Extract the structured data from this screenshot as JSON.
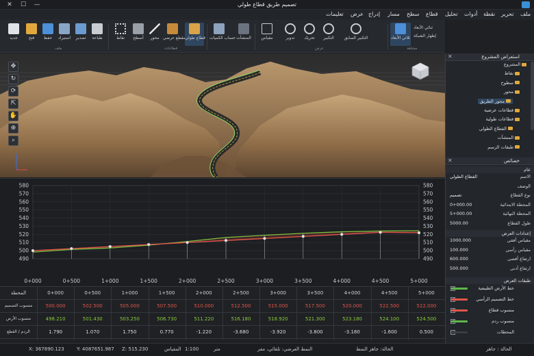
{
  "window": {
    "title": "تصميم طريق قطاع طولي",
    "minimize": "—",
    "maximize": "☐",
    "close": "✕"
  },
  "menu": [
    "ملف",
    "تحرير",
    "نقطة",
    "أدوات",
    "تحليل",
    "قطاع",
    "سطح",
    "مسار",
    "إدراج",
    "عرض",
    "تعليمات"
  ],
  "ribbon": {
    "file_buttons": [
      "جديد",
      "فتح",
      "حفظ",
      "استيراد",
      "تصدير",
      "طباعة"
    ],
    "file_group": "ملف",
    "draw_buttons": [
      "نقاط",
      "أسطح",
      "محور",
      "مقطع عرضي",
      "قطاع طولي"
    ],
    "draw_group": "قطاعات",
    "extra_buttons": [
      "حساب الكميات",
      "المنشآت",
      "مقياس",
      "تدوير",
      "تحريك",
      "التكبير",
      "التكبير السابق"
    ],
    "extra_group": "عرض",
    "view_buttons": [
      "ثلاثي الأبعاد"
    ],
    "view_side": [
      "ثنائي الأبعاد",
      "إظهار الشبكة"
    ],
    "view_group": "مشاهد"
  },
  "profile": {
    "y_ticks": [
      "580",
      "570",
      "560",
      "550",
      "540",
      "530",
      "520",
      "510",
      "500",
      "490"
    ],
    "x_ticks": [
      "0+000",
      "0+500",
      "1+000",
      "1+500",
      "2+000",
      "2+500",
      "3+000",
      "3+500",
      "4+000",
      "4+500",
      "5+000"
    ]
  },
  "table": {
    "header_label": "المحطة",
    "stations": [
      "0+000",
      "0+500",
      "1+000",
      "1+500",
      "2+000",
      "2+500",
      "3+000",
      "3+500",
      "4+000",
      "4+500",
      "5+000"
    ],
    "rows": [
      {
        "label": "منسوب التصميم",
        "color": "#e0564a",
        "values": [
          "500.000",
          "502.500",
          "505.000",
          "507.500",
          "510.000",
          "512.500",
          "515.000",
          "517.500",
          "520.000",
          "522.500",
          "522.000"
        ]
      },
      {
        "label": "منسوب الأرض",
        "color": "#8ccc3c",
        "values": [
          "498.210",
          "501.430",
          "503.250",
          "506.730",
          "511.220",
          "516.180",
          "518.920",
          "521.300",
          "523.180",
          "524.100",
          "524.500"
        ]
      },
      {
        "label": "الردم / القطع",
        "color": "#dcdfe3",
        "values": [
          "1.790",
          "1.070",
          "1.750",
          "0.770",
          "-1.220",
          "-3.680",
          "-3.920",
          "-3.800",
          "-3.180",
          "-1.600",
          "0.500"
        ]
      }
    ]
  },
  "status": {
    "x": "X: 367890.123",
    "y": "Y: 4087651.987",
    "z": "Z: 515.230",
    "scale_label": "المقياس",
    "scale": "1:100",
    "units": "متر",
    "mode": "النمط العرضي: تلقائي، مفر",
    "state_label": "الحالة: جاهز النمط",
    "ready": "الحالة : جاهز"
  },
  "explorer": {
    "title": "استعراض المشروع",
    "items": [
      {
        "label": "المشروع",
        "level": 0
      },
      {
        "label": "نقاط",
        "level": 1
      },
      {
        "label": "سطوح",
        "level": 1
      },
      {
        "label": "محور",
        "level": 1
      },
      {
        "label": "محور الطريق",
        "level": 2,
        "selected": true
      },
      {
        "label": "قطاعات عرضية",
        "level": 1
      },
      {
        "label": "قطاعات طولية",
        "level": 1
      },
      {
        "label": "القطاع الطولي",
        "level": 2
      },
      {
        "label": "المنشآت",
        "level": 1
      },
      {
        "label": "طبقات الرسم",
        "level": 1
      }
    ]
  },
  "properties": {
    "title": "خصائص",
    "general_head": "عام",
    "general": [
      {
        "k": "الاسم",
        "v": "القطاع الطولي"
      },
      {
        "k": "الوصف",
        "v": ""
      },
      {
        "k": "نوع القطاع",
        "v": "تصميم"
      },
      {
        "k": "المحطة الابتدائية",
        "v": "0+000.00"
      },
      {
        "k": "المحطة النهائية",
        "v": "5+000.00"
      },
      {
        "k": "طول القطاع",
        "v": "5000.00"
      }
    ],
    "display_head": "إعدادات العرض",
    "display": [
      {
        "k": "مقياس أفقي",
        "v": "1000.000"
      },
      {
        "k": "مقياس رأسي",
        "v": "100.000"
      },
      {
        "k": "ارتفاع أقصى",
        "v": "600.000"
      },
      {
        "k": "ارتفاع أدنى",
        "v": "500.000"
      }
    ]
  },
  "layers": {
    "title": "طبقات العرض",
    "items": [
      {
        "label": "خط الأرض الطبيعية",
        "color": "#5fb84a"
      },
      {
        "label": "خط التصميم الرأسي",
        "color": "#e0564a"
      },
      {
        "label": "منسوب قطاع",
        "color": "#e0564a"
      },
      {
        "label": "منسوب ردم",
        "color": "#5fb84a"
      },
      {
        "label": "المحطات",
        "color": "#3a3d42"
      }
    ]
  },
  "chart_data": {
    "type": "line",
    "x": [
      0,
      500,
      1000,
      1500,
      2000,
      2500,
      3000,
      3500,
      4000,
      4500,
      5000
    ],
    "series": [
      {
        "name": "خط التصميم الرأسي",
        "values": [
          500,
          502.5,
          505,
          507.5,
          510,
          512.5,
          515,
          517.5,
          520,
          522.5,
          522
        ]
      },
      {
        "name": "خط الأرض الطبيعية",
        "values": [
          498.21,
          501.43,
          503.25,
          506.73,
          511.22,
          516.18,
          518.92,
          521.3,
          523.18,
          524.1,
          524.5
        ]
      }
    ],
    "ylim": [
      490,
      580
    ],
    "xlim": [
      0,
      5000
    ],
    "grid": true
  },
  "colors": {
    "design": "#e0564a",
    "ground": "#7fbf3f",
    "accent": "#3b8fd6"
  }
}
